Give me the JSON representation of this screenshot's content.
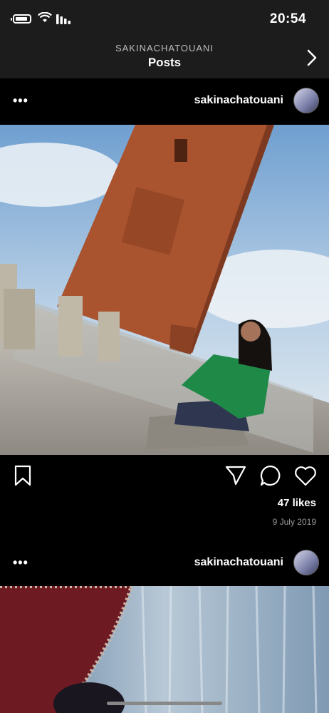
{
  "status_bar": {
    "time": "20:54"
  },
  "nav": {
    "subtitle": "SAKINACHATOUANI",
    "title": "Posts"
  },
  "posts": [
    {
      "username": "sakinachatouani",
      "likes": "47 likes",
      "date": "9 July 2019"
    },
    {
      "username": "sakinachatouani"
    }
  ],
  "icons": {
    "back": "chevron-right-icon",
    "like": "heart-icon",
    "comment": "comment-icon",
    "share": "send-icon",
    "save": "bookmark-icon",
    "more": "more-dots-icon"
  },
  "colors": {
    "background": "#000000",
    "bar": "#1c1c1c",
    "secondary_text": "#999999"
  }
}
